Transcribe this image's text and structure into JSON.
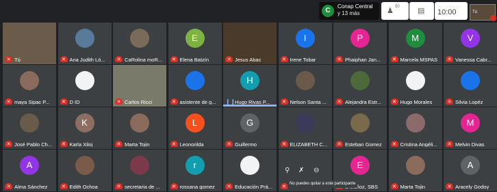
{
  "host": {
    "initial": "C",
    "name": "Conap Central",
    "more": "y 13 más"
  },
  "controls": {
    "participants_count": "50",
    "clock": "10:00",
    "self_label": "Tú"
  },
  "tooltip": "No puedes quitar a este participante",
  "colors": {
    "background": "#202124",
    "tile": "#3c4043",
    "mute_red": "#d93025",
    "speaking_blue": "#8ab4f8",
    "avatar_green": "#1e8e3e",
    "avatar_blue": "#1a73e8",
    "avatar_pink": "#e52592",
    "avatar_purple": "#9334e6",
    "avatar_gray": "#5f6368",
    "avatar_orange": "#f4511e",
    "avatar_brown": "#8d6e63",
    "avatar_teal": "#129eaf"
  },
  "participants": [
    {
      "name": "Tú",
      "initial": "",
      "avatar_color": "#6b5b4b",
      "type": "video",
      "muted": true
    },
    {
      "name": "Ana Judith Ló...",
      "initial": "",
      "avatar_color": "#5a7a9a",
      "type": "photo",
      "muted": true
    },
    {
      "name": "CaRolina moR...",
      "initial": "",
      "avatar_color": "#7a6a5a",
      "type": "photo",
      "muted": true
    },
    {
      "name": "Elena Batzín",
      "initial": "E",
      "avatar_color": "#7cb342",
      "type": "letter",
      "muted": true
    },
    {
      "name": "Jesus Abac",
      "initial": "",
      "avatar_color": "#4a3a2a",
      "type": "video",
      "muted": true
    },
    {
      "name": "Irene Tobar",
      "initial": "I",
      "avatar_color": "#1a73e8",
      "type": "letter",
      "muted": true
    },
    {
      "name": "Phaiphan Jan...",
      "initial": "P",
      "avatar_color": "#e52592",
      "type": "letter",
      "muted": true
    },
    {
      "name": "Marcela MSPAS",
      "initial": "M",
      "avatar_color": "#1e8e3e",
      "type": "letter",
      "muted": true
    },
    {
      "name": "Vanessa Cabr...",
      "initial": "V",
      "avatar_color": "#9334e6",
      "type": "letter",
      "muted": true
    },
    {
      "name": "maya Sipac P...",
      "initial": "",
      "avatar_color": "#8a6a5a",
      "type": "photo",
      "muted": true
    },
    {
      "name": "D ID",
      "initial": "",
      "avatar_color": "#f1f3f4",
      "type": "photo",
      "muted": true
    },
    {
      "name": "Carlos Ricci",
      "initial": "",
      "avatar_color": "#7a7a6a",
      "type": "video",
      "muted": true
    },
    {
      "name": "asistente de g...",
      "initial": "",
      "avatar_color": "#1a73e8",
      "type": "photo",
      "muted": true
    },
    {
      "name": "Hugo Rivas P...",
      "initial": "H",
      "avatar_color": "#129eaf",
      "type": "letter",
      "muted": false
    },
    {
      "name": "Nelson Santa ...",
      "initial": "",
      "avatar_color": "#6a5a4a",
      "type": "photo",
      "muted": true
    },
    {
      "name": "Alejandra Estr...",
      "initial": "",
      "avatar_color": "#4a6a3a",
      "type": "photo",
      "muted": true
    },
    {
      "name": "Hugo Morales",
      "initial": "",
      "avatar_color": "#f1f3f4",
      "type": "photo",
      "muted": true
    },
    {
      "name": "Silvia Lopéz",
      "initial": "",
      "avatar_color": "#1a73e8",
      "type": "photo",
      "muted": true
    },
    {
      "name": "José Pablo Ch...",
      "initial": "",
      "avatar_color": "#6a5a4a",
      "type": "photo",
      "muted": true
    },
    {
      "name": "Karla Xiloj",
      "initial": "K",
      "avatar_color": "#8d6e63",
      "type": "letter",
      "muted": true
    },
    {
      "name": "Marta Tojin",
      "initial": "",
      "avatar_color": "#8a6a5a",
      "type": "photo",
      "muted": true
    },
    {
      "name": "Leonorilda",
      "initial": "L",
      "avatar_color": "#f4511e",
      "type": "letter",
      "muted": true
    },
    {
      "name": "Guillermo",
      "initial": "G",
      "avatar_color": "#5f6368",
      "type": "letter",
      "muted": true
    },
    {
      "name": "ELIZABETH C...",
      "initial": "",
      "avatar_color": "#3a3a5a",
      "type": "photo",
      "muted": true
    },
    {
      "name": "Esteban Gomez",
      "initial": "",
      "avatar_color": "#7a6a4a",
      "type": "photo",
      "muted": true
    },
    {
      "name": "Cristina Angéli...",
      "initial": "",
      "avatar_color": "#8a6a6a",
      "type": "photo",
      "muted": true
    },
    {
      "name": "Melvin Divas",
      "initial": "M",
      "avatar_color": "#e52592",
      "type": "letter",
      "muted": true
    },
    {
      "name": "Alma Sánchez",
      "initial": "A",
      "avatar_color": "#9334e6",
      "type": "letter",
      "muted": true
    },
    {
      "name": "Edith Ochoa",
      "initial": "",
      "avatar_color": "#7a5a4a",
      "type": "photo",
      "muted": true
    },
    {
      "name": "secretaria de ...",
      "initial": "",
      "avatar_color": "#7a3a4a",
      "type": "photo",
      "muted": true
    },
    {
      "name": "rossana gomez",
      "initial": "r",
      "avatar_color": "#129eaf",
      "type": "letter",
      "muted": true
    },
    {
      "name": "Educación Prá...",
      "initial": "",
      "avatar_color": "#f1f3f4",
      "type": "photo",
      "muted": true
    },
    {
      "name": "",
      "initial": "",
      "avatar_color": "#3c4043",
      "type": "hidden",
      "muted": true
    },
    {
      "name": "a Muñoz, SBS",
      "initial": "E",
      "avatar_color": "#e52592",
      "type": "letter",
      "muted": true
    },
    {
      "name": "Marta Tojin",
      "initial": "",
      "avatar_color": "#8a6a5a",
      "type": "photo",
      "muted": true
    },
    {
      "name": "Aracely Godoy",
      "initial": "A",
      "avatar_color": "#5f6368",
      "type": "letter",
      "muted": true
    }
  ]
}
